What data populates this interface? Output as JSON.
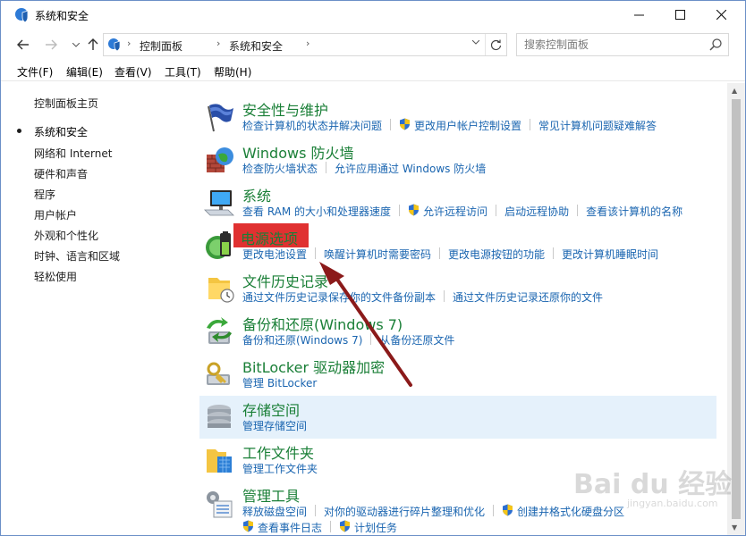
{
  "window": {
    "title": "系统和安全"
  },
  "nav": {
    "breadcrumbs": [
      "控制面板",
      "系统和安全"
    ],
    "search_placeholder": "搜索控制面板"
  },
  "menu": [
    "文件(F)",
    "编辑(E)",
    "查看(V)",
    "工具(T)",
    "帮助(H)"
  ],
  "sidebar": {
    "items": [
      {
        "label": "控制面板主页",
        "current": false
      },
      {
        "label": "系统和安全",
        "current": true
      },
      {
        "label": "网络和 Internet",
        "current": false
      },
      {
        "label": "硬件和声音",
        "current": false
      },
      {
        "label": "程序",
        "current": false
      },
      {
        "label": "用户帐户",
        "current": false
      },
      {
        "label": "外观和个性化",
        "current": false
      },
      {
        "label": "时钟、语言和区域",
        "current": false
      },
      {
        "label": "轻松使用",
        "current": false
      }
    ]
  },
  "categories": [
    {
      "title": "安全性与维护",
      "icon": "flag-icon",
      "links": [
        {
          "label": "检查计算机的状态并解决问题",
          "shield": false
        },
        {
          "label": "更改用户帐户控制设置",
          "shield": true
        },
        {
          "label": "常见计算机问题疑难解答",
          "shield": false
        }
      ]
    },
    {
      "title": "Windows 防火墙",
      "icon": "firewall-icon",
      "links": [
        {
          "label": "检查防火墙状态",
          "shield": false
        },
        {
          "label": "允许应用通过 Windows 防火墙",
          "shield": false
        }
      ]
    },
    {
      "title": "系统",
      "icon": "computer-icon",
      "links": [
        {
          "label": "查看 RAM 的大小和处理器速度",
          "shield": false
        },
        {
          "label": "允许远程访问",
          "shield": true
        },
        {
          "label": "启动远程协助",
          "shield": false
        },
        {
          "label": "查看该计算机的名称",
          "shield": false
        }
      ]
    },
    {
      "title": "电源选项",
      "icon": "battery-icon",
      "links": [
        {
          "label": "更改电池设置",
          "shield": false
        },
        {
          "label": "唤醒计算机时需要密码",
          "shield": false
        },
        {
          "label": "更改电源按钮的功能",
          "shield": false
        },
        {
          "label": "更改计算机睡眠时间",
          "shield": false
        }
      ]
    },
    {
      "title": "文件历史记录",
      "icon": "file-history-icon",
      "links": [
        {
          "label": "通过文件历史记录保存你的文件备份副本",
          "shield": false
        },
        {
          "label": "通过文件历史记录还原你的文件",
          "shield": false
        }
      ]
    },
    {
      "title": "备份和还原(Windows 7)",
      "icon": "backup-icon",
      "links": [
        {
          "label": "备份和还原(Windows 7)",
          "shield": false
        },
        {
          "label": "从备份还原文件",
          "shield": false
        }
      ]
    },
    {
      "title": "BitLocker 驱动器加密",
      "icon": "bitlocker-icon",
      "links": [
        {
          "label": "管理 BitLocker",
          "shield": false
        }
      ]
    },
    {
      "title": "存储空间",
      "icon": "storage-icon",
      "links": [
        {
          "label": "管理存储空间",
          "shield": false
        }
      ]
    },
    {
      "title": "工作文件夹",
      "icon": "work-folders-icon",
      "links": [
        {
          "label": "管理工作文件夹",
          "shield": false
        }
      ]
    },
    {
      "title": "管理工具",
      "icon": "admin-tools-icon",
      "links": [
        {
          "label": "释放磁盘空间",
          "shield": false
        },
        {
          "label": "对你的驱动器进行碎片整理和优化",
          "shield": false
        },
        {
          "label": "创建并格式化硬盘分区",
          "shield": true
        }
      ]
    },
    {
      "title": "",
      "icon": "",
      "links": [
        {
          "label": "查看事件日志",
          "shield": true
        },
        {
          "label": "计划任务",
          "shield": true
        }
      ]
    }
  ],
  "watermark": {
    "text": "Bai du 经验",
    "sub": "jingyan.baidu.com"
  },
  "colors": {
    "title_green": "#1a7f37",
    "link_blue": "#1a65b0",
    "highlight_red": "#e03131",
    "arrow": "#8b1a1a",
    "row_hover": "#e5f1fb"
  }
}
